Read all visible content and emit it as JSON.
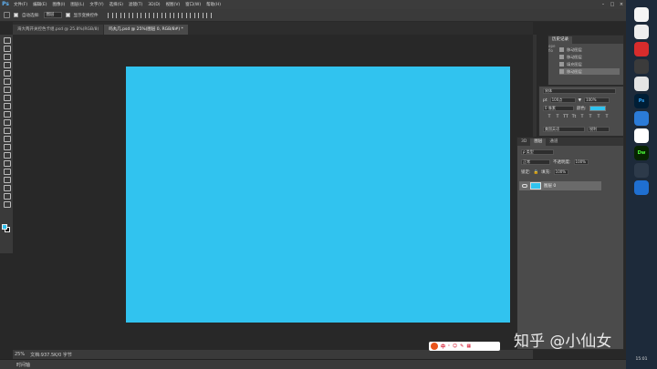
{
  "app": {
    "logo": "Ps"
  },
  "menu": [
    "文件(F)",
    "编辑(E)",
    "图像(I)",
    "图层(L)",
    "文字(Y)",
    "选择(S)",
    "滤镜(T)",
    "3D(D)",
    "视图(V)",
    "窗口(W)",
    "帮助(H)"
  ],
  "window_controls": [
    "–",
    "□",
    "×"
  ],
  "options": {
    "auto_select_label": "自动选择:",
    "auto_select_value": "图层",
    "show_transform_label": "显示变换控件"
  },
  "tabs": [
    {
      "label": "海大两开关控色卡组.psd @ 25.8%(RGB/8)",
      "active": false
    },
    {
      "label": "吗丸几.psd @ 25%(图层 0, RGB/8#) *",
      "active": true
    }
  ],
  "status": {
    "zoom": "25%",
    "doc": "文档:937.5K/0 字节"
  },
  "timeline_label": "时间轴",
  "history": {
    "tab": "历史记录",
    "side": [
      "ope",
      "fio"
    ],
    "items": [
      "移动图层",
      "移动图层",
      "填充图层",
      "移动图层"
    ]
  },
  "character": {
    "font": "宋体",
    "size_label": "pt",
    "size_value": "100点",
    "leading_value": "100%",
    "tracking_value": "0 像素",
    "color_label": "颜色:",
    "lang": "美国英语",
    "aa": "锐利"
  },
  "layers": {
    "tabs": [
      "3D",
      "图层",
      "通道"
    ],
    "filter_label": "ρ 类型",
    "blend_mode": "正常",
    "opacity_label": "不透明度:",
    "opacity_value": "100%",
    "lock_label": "锁定:",
    "fill_label": "填充:",
    "fill_value": "100%",
    "layer_name": "图层 0"
  },
  "taskbar": {
    "icons": [
      {
        "name": "ps-task-icon",
        "label": "Ps",
        "color": "#001e36"
      },
      {
        "name": "dw-task-icon",
        "label": "Dw",
        "color": "#072401"
      }
    ],
    "time": "15:01"
  },
  "watermark": "知乎 @小仙女",
  "ime": [
    "中",
    "·",
    "☺",
    "✎",
    "▦"
  ]
}
